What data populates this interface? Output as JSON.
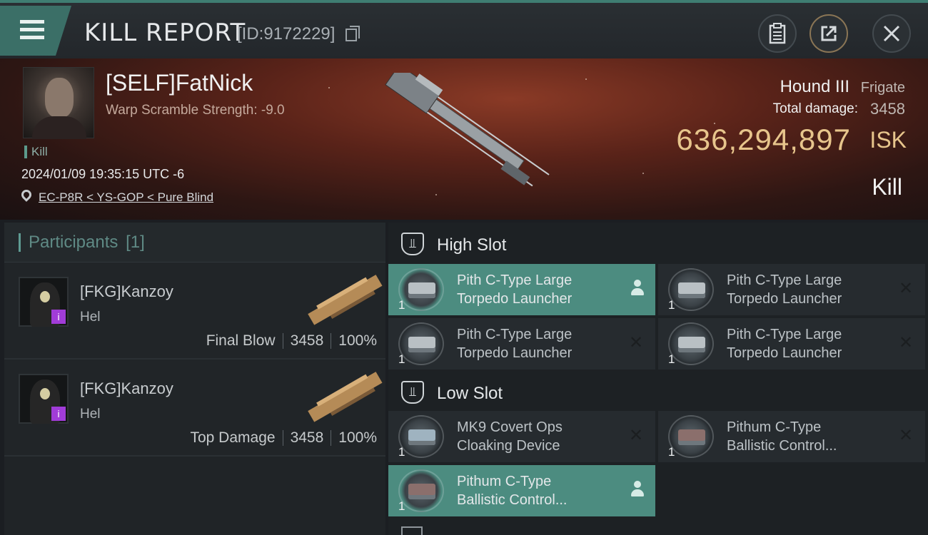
{
  "header": {
    "title": "KILL REPORT",
    "report_id": "[ID:9172229]",
    "buttons": [
      "clipboard-icon",
      "share-icon",
      "close-icon"
    ]
  },
  "victim": {
    "name": "[SELF]FatNick",
    "warp_scramble": "Warp Scramble Strength: -9.0",
    "tag": "Kill",
    "datetime": "2024/01/09 19:35:15 UTC -6",
    "location": "EC-P8R < YS-GOP < Pure Blind",
    "ship_name": "Hound III",
    "ship_class": "Frigate",
    "total_damage_label": "Total damage:",
    "total_damage": "3458",
    "isk_value": "636,294,897",
    "isk_unit": "ISK",
    "result": "Kill"
  },
  "participants": {
    "title": "Participants",
    "count": "[1]",
    "rows": [
      {
        "name": "[FKG]Kanzoy",
        "ship": "Hel",
        "label": "Final Blow",
        "damage": "3458",
        "percent": "100%"
      },
      {
        "name": "[FKG]Kanzoy",
        "ship": "Hel",
        "label": "Top Damage",
        "damage": "3458",
        "percent": "100%"
      }
    ]
  },
  "fitting": {
    "high_slot": {
      "title": "High Slot",
      "modules": [
        {
          "line1": "Pith C-Type Large",
          "line2": "Torpedo Launcher",
          "qty": "1",
          "status": "dropped"
        },
        {
          "line1": "Pith C-Type Large",
          "line2": "Torpedo Launcher",
          "qty": "1",
          "status": "destroyed"
        },
        {
          "line1": "Pith C-Type Large",
          "line2": "Torpedo Launcher",
          "qty": "1",
          "status": "destroyed"
        },
        {
          "line1": "Pith C-Type Large",
          "line2": "Torpedo Launcher",
          "qty": "1",
          "status": "destroyed"
        }
      ]
    },
    "low_slot": {
      "title": "Low Slot",
      "modules": [
        {
          "line1": "MK9 Covert Ops",
          "line2": "Cloaking Device",
          "qty": "1",
          "status": "destroyed"
        },
        {
          "line1": "Pithum C-Type",
          "line2": "Ballistic Control...",
          "qty": "1",
          "status": "destroyed"
        },
        {
          "line1": "Pithum C-Type",
          "line2": "Ballistic Control...",
          "qty": "1",
          "status": "dropped"
        }
      ]
    },
    "status_glyph": "✕"
  }
}
